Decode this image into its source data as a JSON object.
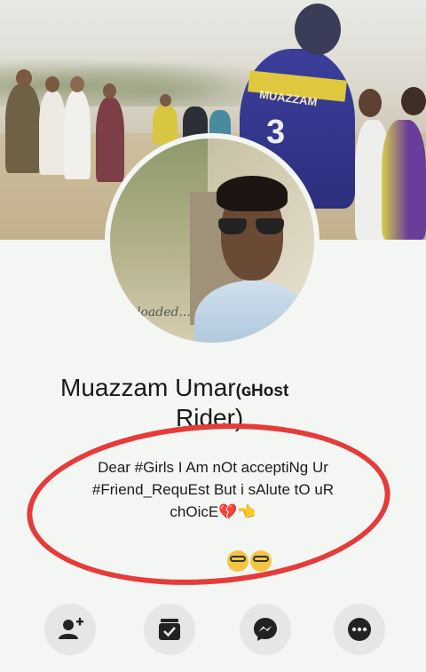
{
  "profile": {
    "name": "Muazzam Umar",
    "name_suffix": "(ɢHost",
    "name_suffix_line2": "Rider)",
    "bio_line1": "Dear #Girls I Am nOt acceptiNg Ur",
    "bio_line2": "#Friend_RequEst But i sAlute tO uR",
    "bio_line3": "chOicE",
    "avatar_watermark": "loaded..."
  },
  "cover": {
    "jersey_text": "MUAZZAM",
    "jersey_number": "3"
  },
  "actions": [
    {
      "icon": "add-friend-icon"
    },
    {
      "icon": "follow-icon"
    },
    {
      "icon": "messenger-icon"
    },
    {
      "icon": "more-icon"
    }
  ],
  "colors": {
    "annotation_ring": "#e53b3b",
    "background": "#f3f6f2",
    "action_bg": "#e4e7e4"
  }
}
